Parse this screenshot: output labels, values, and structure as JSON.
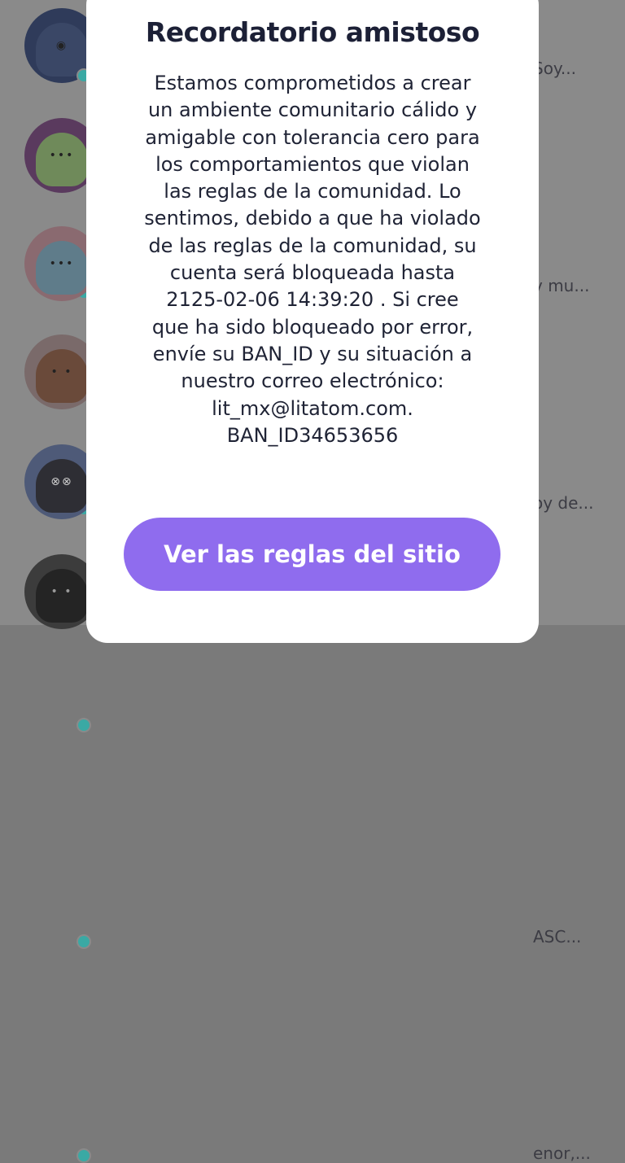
{
  "background_list": {
    "rows": [
      {
        "snippet": "Soy..."
      },
      {
        "snippet": "y mu..."
      },
      {
        "snippet": "oy de..."
      },
      {
        "snippet": ""
      },
      {
        "snippet": "ASC..."
      },
      {
        "snippet": "enor,..."
      }
    ]
  },
  "modal": {
    "title": "Recordatorio amistoso",
    "body_lines": [
      "Estamos comprometidos a crear",
      "un ambiente comunitario cálido y",
      "amigable con tolerancia cero para",
      "los comportamientos que violan",
      "las reglas de la comunidad. Lo",
      "sentimos, debido a que ha violado",
      "de las reglas de la comunidad, su",
      "cuenta será bloqueada hasta",
      "2125-02-06 14:39:20 . Si cree",
      "que ha sido bloqueado por error,",
      "envíe su BAN_ID y su situación a",
      "nuestro correo electrónico:",
      "lit_mx@litatom.com.",
      "BAN_ID34653656"
    ],
    "button_label": "Ver las reglas del sitio"
  },
  "colors": {
    "accent": "#8f6cee",
    "text_dark": "#1f2335",
    "online_dot": "#3aa9a4"
  }
}
